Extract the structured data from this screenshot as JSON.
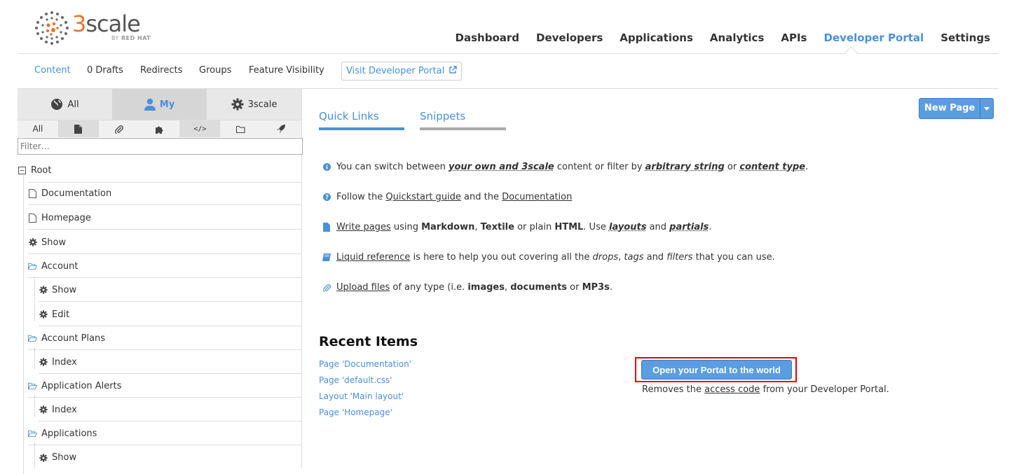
{
  "header": {
    "logo": {
      "brand": "3scale",
      "brand_number": "3",
      "brand_rest": "scale",
      "sub_prefix": "BY",
      "sub_brand": "RED HAT"
    },
    "nav": [
      {
        "label": "Dashboard",
        "active": false
      },
      {
        "label": "Developers",
        "active": false
      },
      {
        "label": "Applications",
        "active": false
      },
      {
        "label": "Analytics",
        "active": false
      },
      {
        "label": "APIs",
        "active": false
      },
      {
        "label": "Developer Portal",
        "active": true
      },
      {
        "label": "Settings",
        "active": false
      }
    ]
  },
  "subnav": {
    "content": "Content",
    "drafts": "0 Drafts",
    "redirects": "Redirects",
    "groups": "Groups",
    "feature_visibility": "Feature Visibility",
    "visit_portal": "Visit Developer Portal"
  },
  "sidebar": {
    "owner_tabs": [
      {
        "label": "All",
        "icon": "globe-icon",
        "active": false
      },
      {
        "label": "My",
        "icon": "user-icon",
        "active": true
      },
      {
        "label": "3scale",
        "icon": "gear-icon",
        "active": false
      }
    ],
    "type_tabs": [
      {
        "label": "All",
        "icon": "",
        "active": false
      },
      {
        "label": "",
        "icon": "file-icon",
        "active": true
      },
      {
        "label": "",
        "icon": "paperclip-icon",
        "active": false
      },
      {
        "label": "",
        "icon": "puzzle-icon",
        "active": false
      },
      {
        "label": "</>",
        "icon": "code-icon",
        "active": true
      },
      {
        "label": "",
        "icon": "folder-icon",
        "active": false
      },
      {
        "label": "",
        "icon": "rocket-icon",
        "active": false
      }
    ],
    "filter_placeholder": "Filter…",
    "tree": [
      {
        "label": "Root",
        "icon": "collapse-icon",
        "depth": 0
      },
      {
        "label": "Documentation",
        "icon": "file-icon",
        "depth": 1
      },
      {
        "label": "Homepage",
        "icon": "file-icon",
        "depth": 1
      },
      {
        "label": "Show",
        "icon": "gear-icon",
        "depth": 1
      },
      {
        "label": "Account",
        "icon": "folder-open-icon",
        "depth": 1
      },
      {
        "label": "Show",
        "icon": "gear-icon",
        "depth": 2
      },
      {
        "label": "Edit",
        "icon": "gear-icon",
        "depth": 2
      },
      {
        "label": "Account Plans",
        "icon": "folder-open-icon",
        "depth": 1
      },
      {
        "label": "Index",
        "icon": "gear-icon",
        "depth": 2
      },
      {
        "label": "Application Alerts",
        "icon": "folder-open-icon",
        "depth": 1
      },
      {
        "label": "Index",
        "icon": "gear-icon",
        "depth": 2
      },
      {
        "label": "Applications",
        "icon": "folder-open-icon",
        "depth": 1
      },
      {
        "label": "Show",
        "icon": "gear-icon",
        "depth": 2
      }
    ]
  },
  "content": {
    "tabs": [
      {
        "label": "Quick Links",
        "active": true
      },
      {
        "label": "Snippets",
        "active": false
      }
    ],
    "new_page": "New Page",
    "quick_links": {
      "switch": {
        "t1": "You can switch between ",
        "b1": "your own and 3scale",
        "t2": " content or filter by ",
        "b2": "arbitrary string",
        "t3": " or ",
        "b3": "content type",
        "t4": "."
      },
      "follow": {
        "t1": "Follow the ",
        "l1": "Quickstart guide",
        "t2": " and the ",
        "l2": "Documentation"
      },
      "write": {
        "l1": "Write pages",
        "t1": " using ",
        "b1": "Markdown",
        "t2": ", ",
        "b2": "Textile",
        "t3": " or plain ",
        "b3": "HTML",
        "t4": ". Use ",
        "b4": "layouts",
        "t5": " and ",
        "b5": "partials",
        "t6": "."
      },
      "liquid": {
        "l1": "Liquid reference",
        "t1": " is here to help you out covering all the ",
        "i1": "drops",
        "t2": ", ",
        "i2": "tags",
        "t3": " and ",
        "i3": "filters",
        "t4": " that you can use."
      },
      "upload": {
        "l1": "Upload files",
        "t1": " of any type (i.e. ",
        "b1": "images",
        "t2": ", ",
        "b2": "documents",
        "t3": " or ",
        "b3": "MP3s",
        "t4": "."
      }
    },
    "recent_title": "Recent Items",
    "recent_items": [
      "Page 'Documentation'",
      "Page 'default.css'",
      "Layout 'Main layout'",
      "Page 'Homepage'"
    ],
    "open_portal": {
      "button": "Open your Portal to the world",
      "desc_t1": "Removes the ",
      "desc_link": "access code",
      "desc_t2": " from your Developer Portal."
    }
  },
  "colors": {
    "accent": "#4a90d9",
    "button": "#5a9de0",
    "highlight": "#e00000",
    "brand_orange": "#e8762b"
  }
}
